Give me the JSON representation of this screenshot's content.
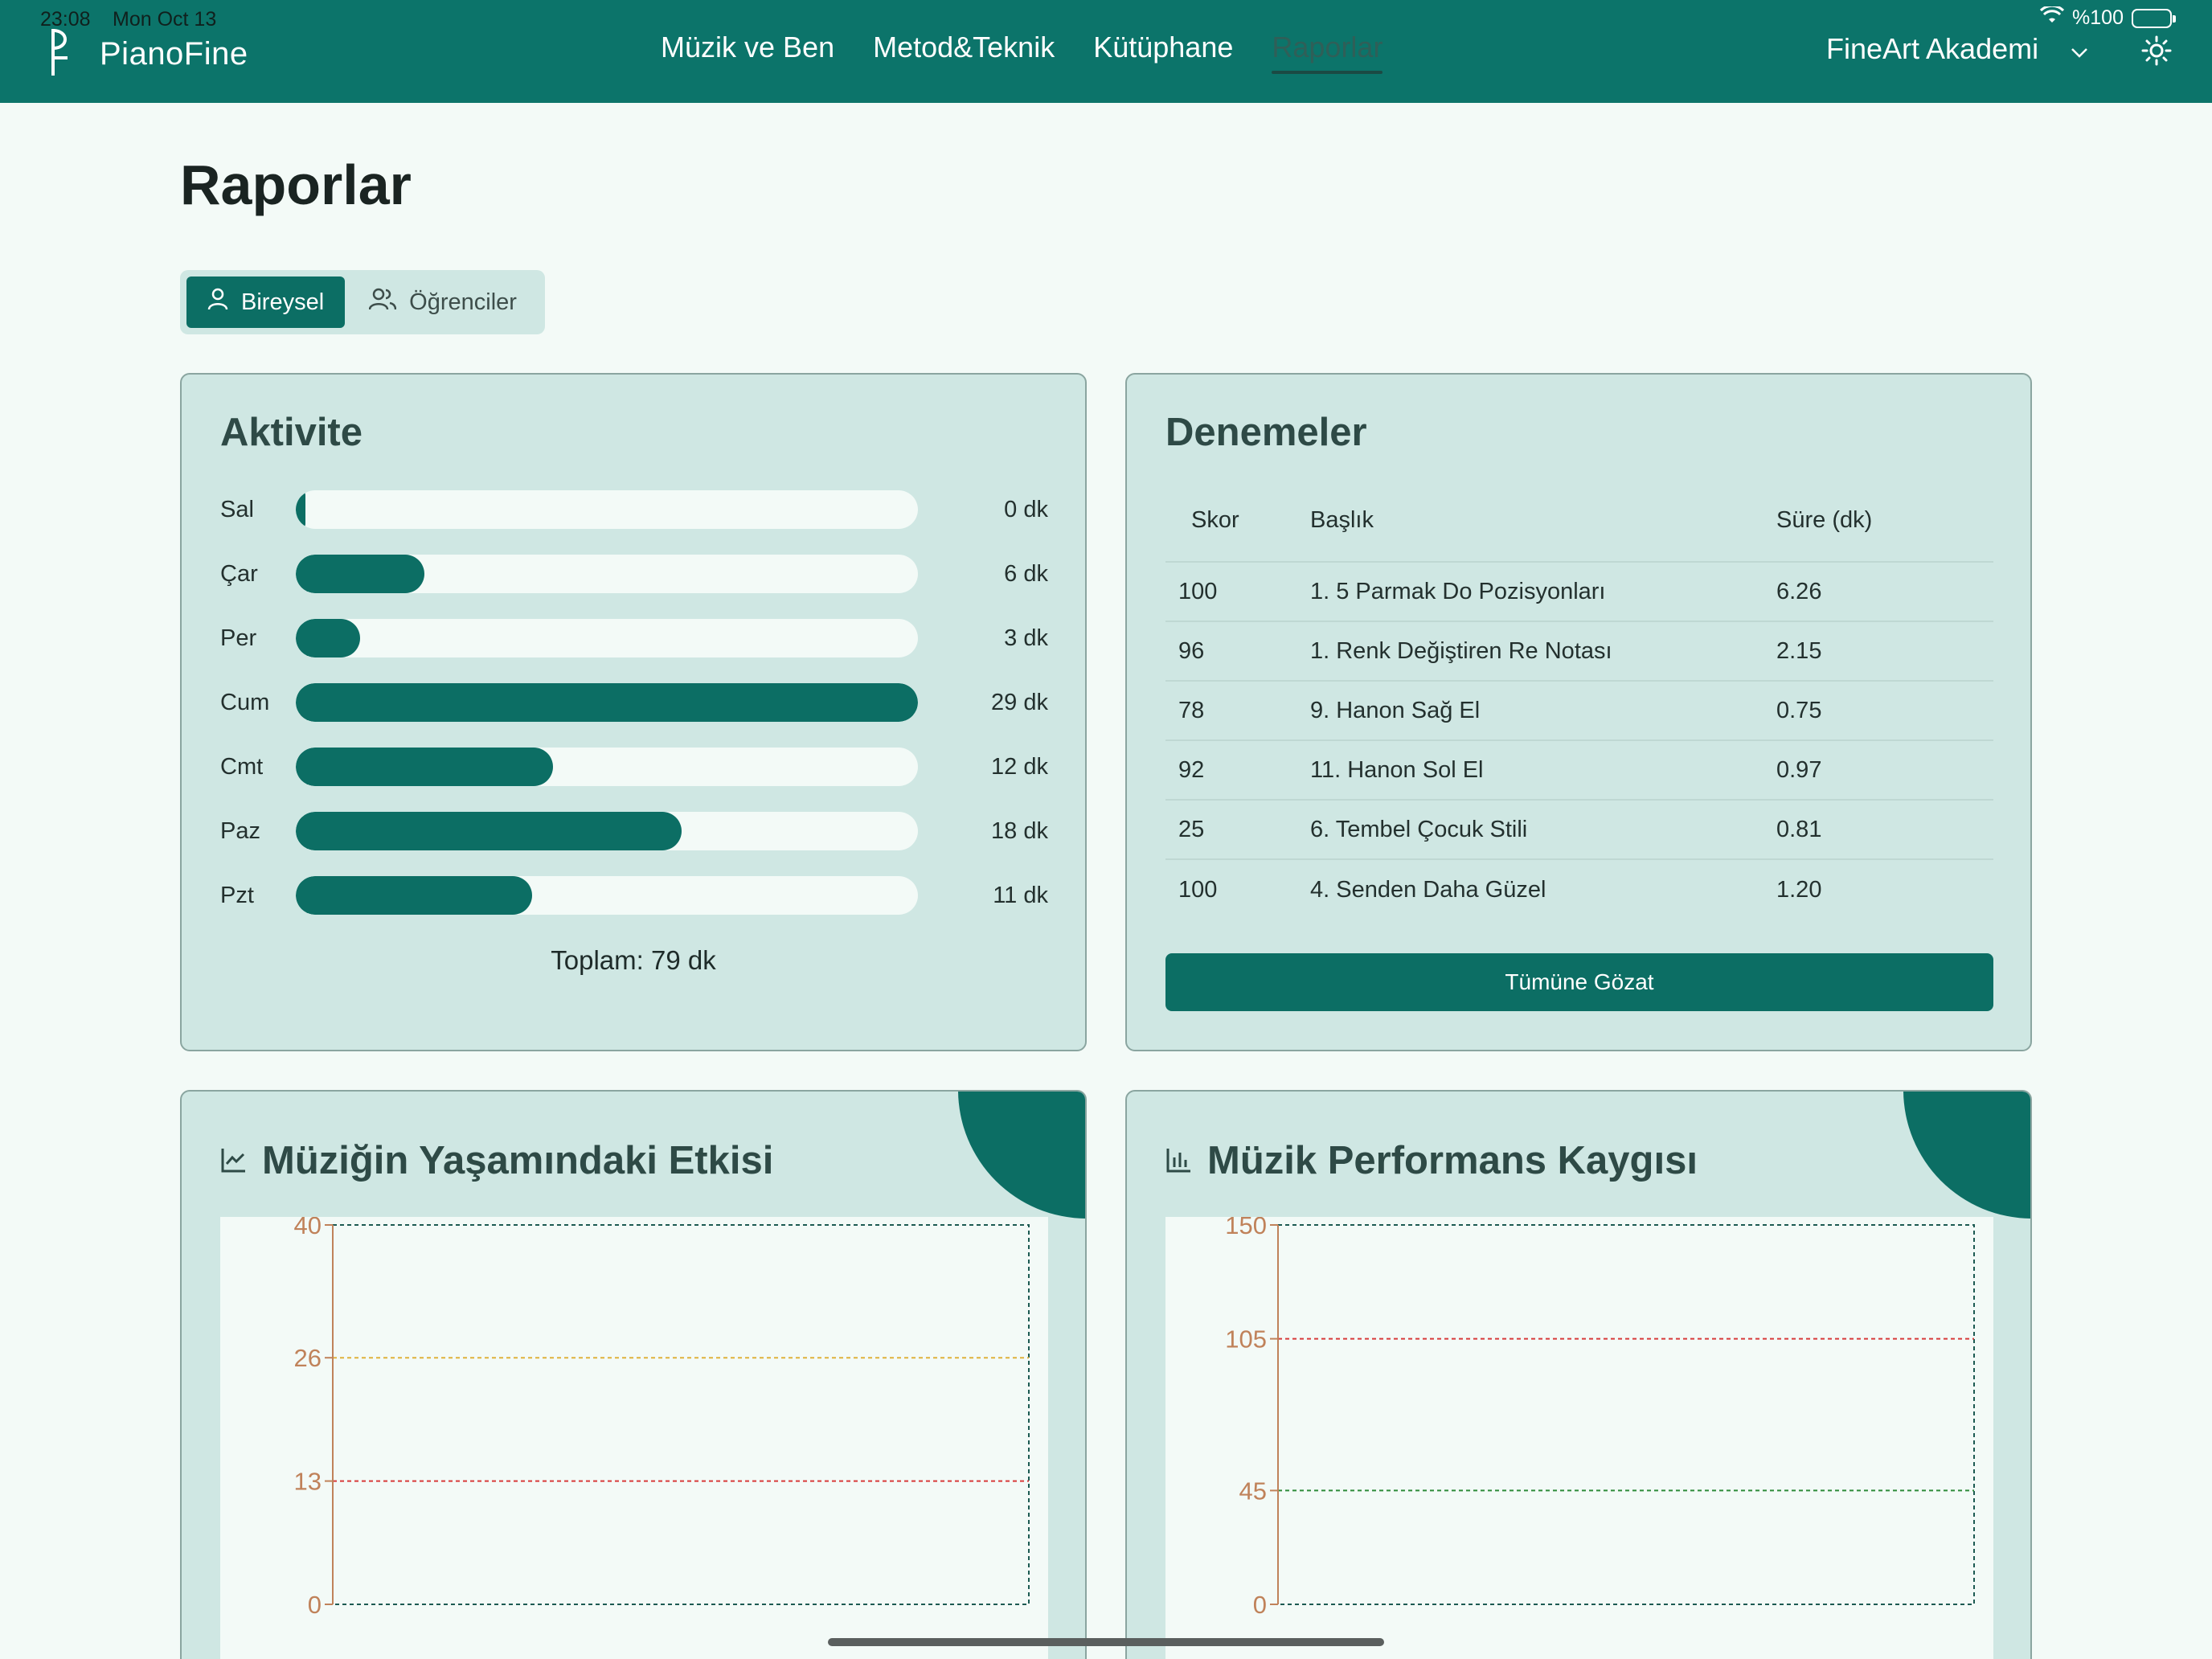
{
  "status_bar": {
    "time": "23:08",
    "date": "Mon Oct 13",
    "battery": "%100"
  },
  "app": {
    "name": "PianoFine"
  },
  "nav": {
    "items": [
      "Müzik ve Ben",
      "Metod&Teknik",
      "Kütüphane",
      "Raporlar"
    ],
    "active": "Raporlar"
  },
  "org": {
    "name": "FineArt Akademi"
  },
  "page": {
    "title": "Raporlar"
  },
  "segments": {
    "individual": "Bireysel",
    "students": "Öğrenciler",
    "active": "Bireysel"
  },
  "activity": {
    "title": "Aktivite",
    "rows": [
      {
        "day": "Sal",
        "label": "0 dk",
        "minutes": 0
      },
      {
        "day": "Çar",
        "label": "6 dk",
        "minutes": 6
      },
      {
        "day": "Per",
        "label": "3 dk",
        "minutes": 3
      },
      {
        "day": "Cum",
        "label": "29 dk",
        "minutes": 29
      },
      {
        "day": "Cmt",
        "label": "12 dk",
        "minutes": 12
      },
      {
        "day": "Paz",
        "label": "18 dk",
        "minutes": 18
      },
      {
        "day": "Pzt",
        "label": "11 dk",
        "minutes": 11
      }
    ],
    "max_minutes": 29,
    "total": "Toplam: 79 dk"
  },
  "trials": {
    "title": "Denemeler",
    "headers": [
      "Skor",
      "Başlık",
      "Süre (dk)"
    ],
    "rows": [
      [
        "100",
        "1. 5 Parmak Do Pozisyonları",
        "6.26"
      ],
      [
        "96",
        "1. Renk Değiştiren Re Notası",
        "2.15"
      ],
      [
        "78",
        "9. Hanon Sağ El",
        "0.75"
      ],
      [
        "92",
        "11. Hanon Sol El",
        "0.97"
      ],
      [
        "25",
        "6. Tembel Çocuk Stili",
        "0.81"
      ],
      [
        "100",
        "4. Senden Daha Güzel",
        "1.20"
      ]
    ],
    "button": "Tümüne Gözat"
  },
  "chart_data": [
    {
      "type": "line",
      "title": "Müziğin Yaşamındaki Etkisi",
      "ylim": [
        0,
        40
      ],
      "yticks": [
        0,
        13,
        26,
        40
      ],
      "reference_lines": [
        {
          "y": 26,
          "color": "#e0b23c"
        },
        {
          "y": 13,
          "color": "#d83a3a"
        }
      ],
      "series": [],
      "grid": false,
      "accent": "#0c6e64",
      "axis_color": "#c0825a"
    },
    {
      "type": "bar",
      "title": "Müzik Performans Kaygısı",
      "ylim": [
        0,
        150
      ],
      "yticks": [
        0,
        45,
        105,
        150
      ],
      "reference_lines": [
        {
          "y": 105,
          "color": "#d83a3a"
        },
        {
          "y": 45,
          "color": "#2e8b3a"
        }
      ],
      "series": [],
      "grid": false,
      "accent": "#0c6e64",
      "axis_color": "#c0825a"
    }
  ]
}
